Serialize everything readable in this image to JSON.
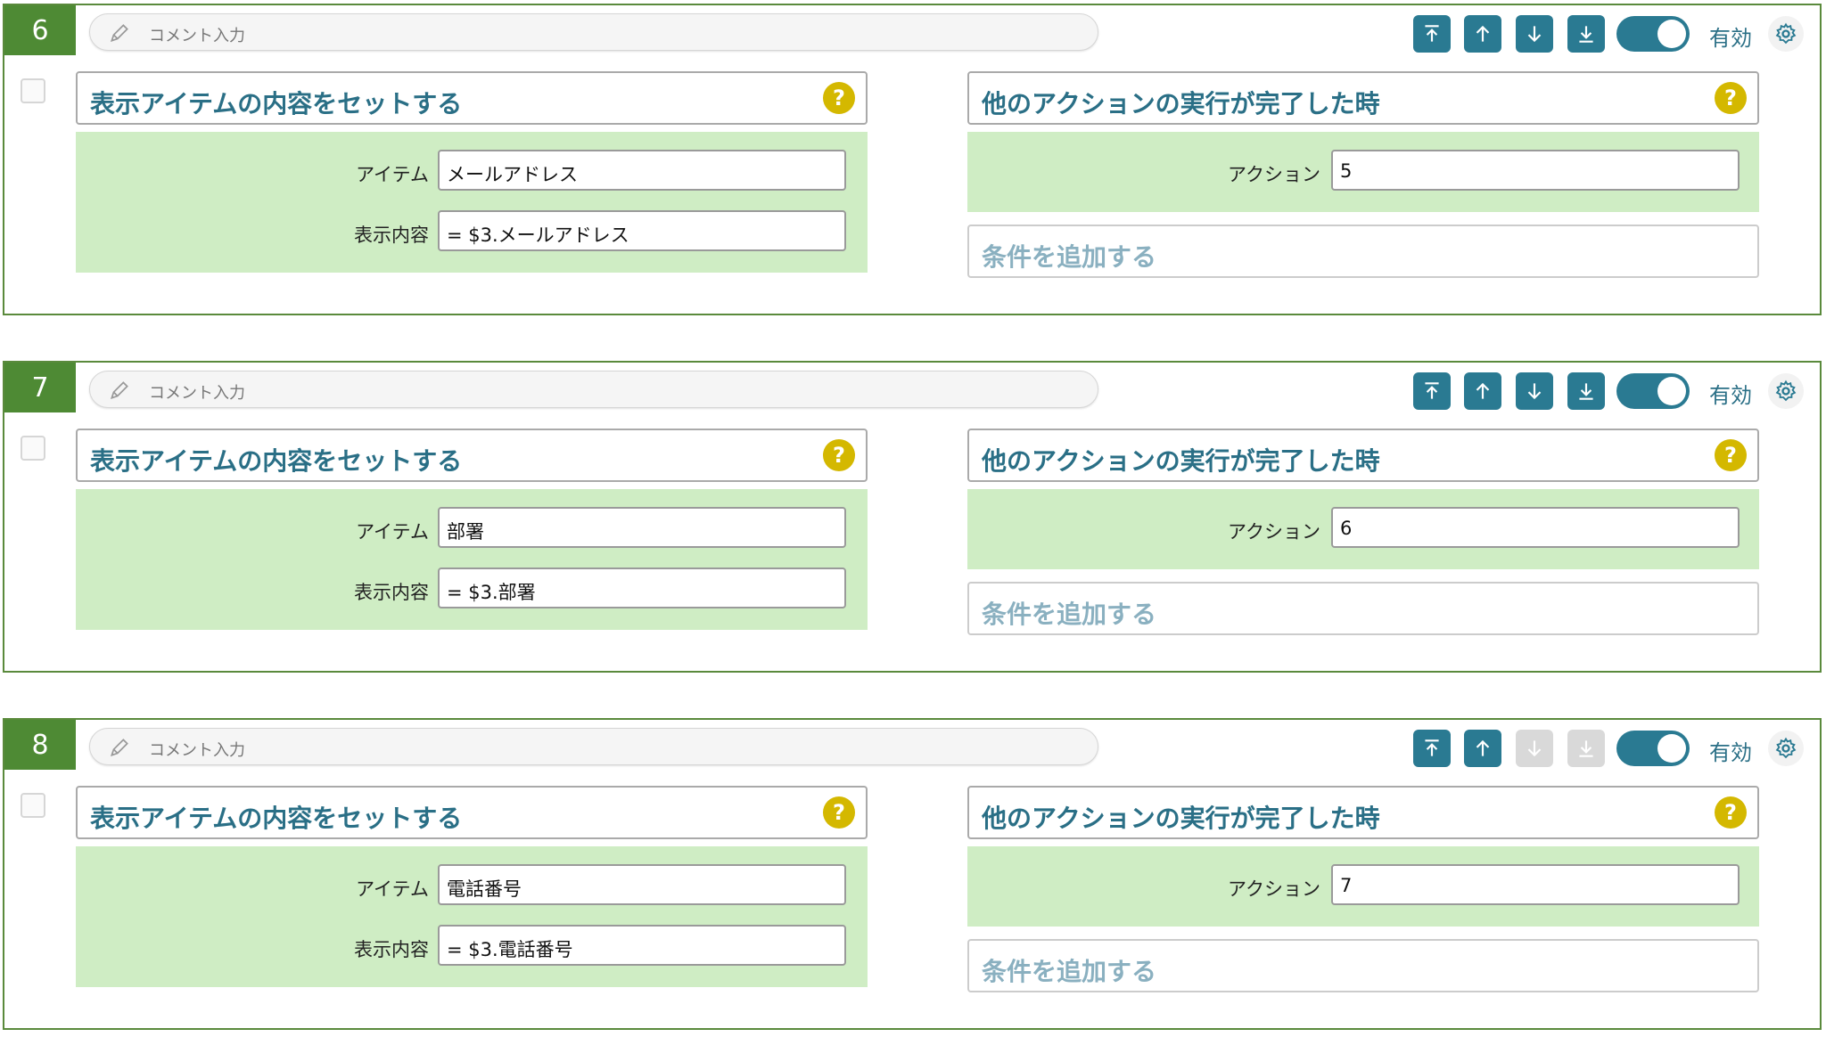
{
  "colors": {
    "number_bg": "#4e8a34",
    "card_border": "#5a8a3c",
    "accent": "#2a7a92",
    "title_text": "#2a6f86",
    "help_badge": "#d4b800",
    "panel_bg": "#cfedc4",
    "disabled_button": "#d9d9d9"
  },
  "cards": [
    {
      "number": "6",
      "comment_placeholder": "コメント入力",
      "valid_label": "有効",
      "left_title": "表示アイテムの内容をセットする",
      "item_label": "アイテム",
      "item_value": "メールアドレス",
      "display_label": "表示内容",
      "display_value": "= $3.メールアドレス",
      "right_title": "他のアクションの実行が完了した時",
      "action_label": "アクション",
      "action_value": "5",
      "add_condition": "条件を追加する",
      "help": "?",
      "down_enabled": true
    },
    {
      "number": "7",
      "comment_placeholder": "コメント入力",
      "valid_label": "有効",
      "left_title": "表示アイテムの内容をセットする",
      "item_label": "アイテム",
      "item_value": "部署",
      "display_label": "表示内容",
      "display_value": "= $3.部署",
      "right_title": "他のアクションの実行が完了した時",
      "action_label": "アクション",
      "action_value": "6",
      "add_condition": "条件を追加する",
      "help": "?",
      "down_enabled": true
    },
    {
      "number": "8",
      "comment_placeholder": "コメント入力",
      "valid_label": "有効",
      "left_title": "表示アイテムの内容をセットする",
      "item_label": "アイテム",
      "item_value": "電話番号",
      "display_label": "表示内容",
      "display_value": "= $3.電話番号",
      "right_title": "他のアクションの実行が完了した時",
      "action_label": "アクション",
      "action_value": "7",
      "add_condition": "条件を追加する",
      "help": "?",
      "down_enabled": false
    }
  ]
}
